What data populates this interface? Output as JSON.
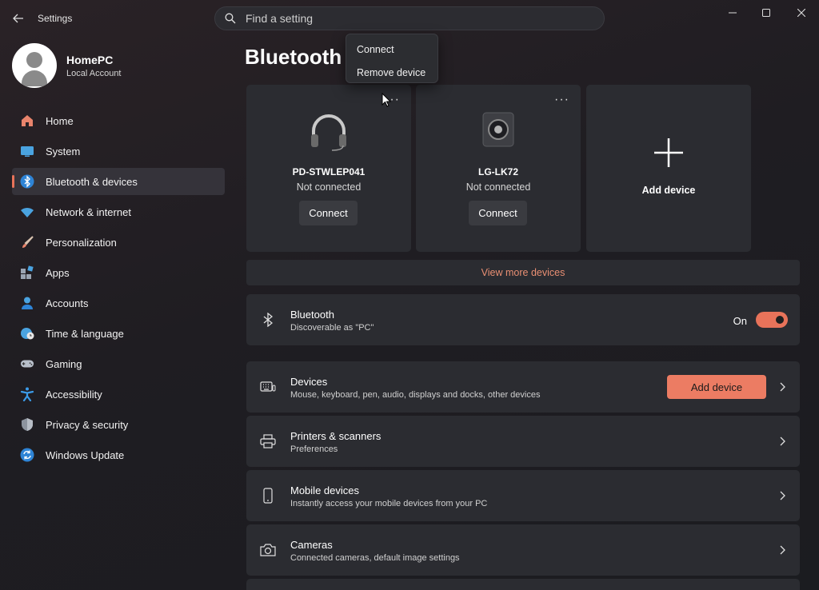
{
  "window": {
    "title": "Settings"
  },
  "search": {
    "placeholder": "Find a setting"
  },
  "profile": {
    "name": "HomePC",
    "account_type": "Local Account"
  },
  "sidebar": {
    "items": [
      {
        "label": "Home",
        "icon": "home-icon"
      },
      {
        "label": "System",
        "icon": "system-icon"
      },
      {
        "label": "Bluetooth & devices",
        "icon": "bluetooth-icon",
        "active": true
      },
      {
        "label": "Network & internet",
        "icon": "wifi-icon"
      },
      {
        "label": "Personalization",
        "icon": "brush-icon"
      },
      {
        "label": "Apps",
        "icon": "apps-icon"
      },
      {
        "label": "Accounts",
        "icon": "accounts-icon"
      },
      {
        "label": "Time & language",
        "icon": "globe-clock-icon"
      },
      {
        "label": "Gaming",
        "icon": "gamepad-icon"
      },
      {
        "label": "Accessibility",
        "icon": "accessibility-icon"
      },
      {
        "label": "Privacy & security",
        "icon": "shield-icon"
      },
      {
        "label": "Windows Update",
        "icon": "update-icon"
      }
    ]
  },
  "page": {
    "title": "Bluetooth"
  },
  "context_menu": {
    "items": [
      "Connect",
      "Remove device"
    ]
  },
  "devices": [
    {
      "name": "PD-STWLEP041",
      "status": "Not connected",
      "button": "Connect",
      "icon": "headphones-icon"
    },
    {
      "name": "LG-LK72",
      "status": "Not connected",
      "button": "Connect",
      "icon": "speaker-icon"
    }
  ],
  "add_card": {
    "label": "Add device"
  },
  "view_more": {
    "label": "View more devices"
  },
  "bluetooth_row": {
    "title": "Bluetooth",
    "subtitle": "Discoverable as \"PC\"",
    "toggle_label": "On",
    "toggle_on": true
  },
  "settings_rows": [
    {
      "title": "Devices",
      "subtitle": "Mouse, keyboard, pen, audio, displays and docks, other devices",
      "icon": "keyboard-icon",
      "button": "Add device"
    },
    {
      "title": "Printers & scanners",
      "subtitle": "Preferences",
      "icon": "printer-icon"
    },
    {
      "title": "Mobile devices",
      "subtitle": "Instantly access your mobile devices from your PC",
      "icon": "phone-icon"
    },
    {
      "title": "Cameras",
      "subtitle": "Connected cameras, default image settings",
      "icon": "camera-icon"
    }
  ],
  "colors": {
    "accent": "#e8735a",
    "background": "#202024",
    "card": "#2b2c31",
    "link": "#e98f73"
  }
}
